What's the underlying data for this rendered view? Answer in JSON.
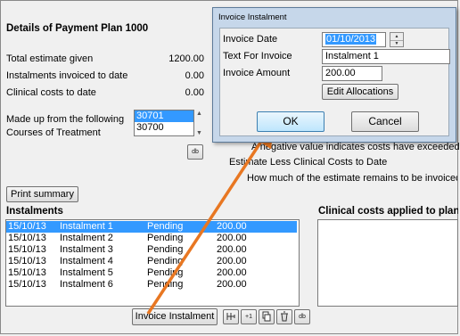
{
  "plan": {
    "title": "Details of Payment Plan 1000",
    "total_estimate_label": "Total estimate given",
    "total_estimate_value": "1200.00",
    "instalments_invoiced_label": "Instalments invoiced to date",
    "instalments_invoiced_value": "0.00",
    "clinical_costs_label": "Clinical costs to date",
    "clinical_costs_value": "0.00",
    "made_up_label_1": "Made up from the following",
    "made_up_label_2": "Courses of Treatment",
    "courses": [
      "30701",
      "30700"
    ],
    "courses_button": "db",
    "print_summary": "Print summary",
    "negative_note": "A negative value indicates costs have exceeded t",
    "estimate_less": "Estimate Less Clinical Costs to Date",
    "how_much": "How much of the estimate remains to be invoiced"
  },
  "instalments": {
    "header": "Instalments",
    "rows": [
      {
        "date": "15/10/13",
        "name": "Instalment 1",
        "status": "Pending",
        "amount": "200.00"
      },
      {
        "date": "15/10/13",
        "name": "Instalment 2",
        "status": "Pending",
        "amount": "200.00"
      },
      {
        "date": "15/10/13",
        "name": "Instalment 3",
        "status": "Pending",
        "amount": "200.00"
      },
      {
        "date": "15/10/13",
        "name": "Instalment 4",
        "status": "Pending",
        "amount": "200.00"
      },
      {
        "date": "15/10/13",
        "name": "Instalment 5",
        "status": "Pending",
        "amount": "200.00"
      },
      {
        "date": "15/10/13",
        "name": "Instalment 6",
        "status": "Pending",
        "amount": "200.00"
      }
    ],
    "selected_row": 0,
    "invoice_button": "Invoice Instalment",
    "tool_buttons": [
      "+1",
      "db"
    ]
  },
  "clinical_costs": {
    "header": "Clinical costs applied to plan"
  },
  "dialog": {
    "title": "Invoice Instalment",
    "invoice_date_label": "Invoice Date",
    "invoice_date_value": "01/10/2013",
    "text_label": "Text For Invoice",
    "text_value": "Instalment 1",
    "amount_label": "Invoice Amount",
    "amount_value": "200.00",
    "edit_allocations": "Edit Allocations",
    "ok": "OK",
    "cancel": "Cancel"
  },
  "annotation": {
    "color": "#e87722"
  }
}
